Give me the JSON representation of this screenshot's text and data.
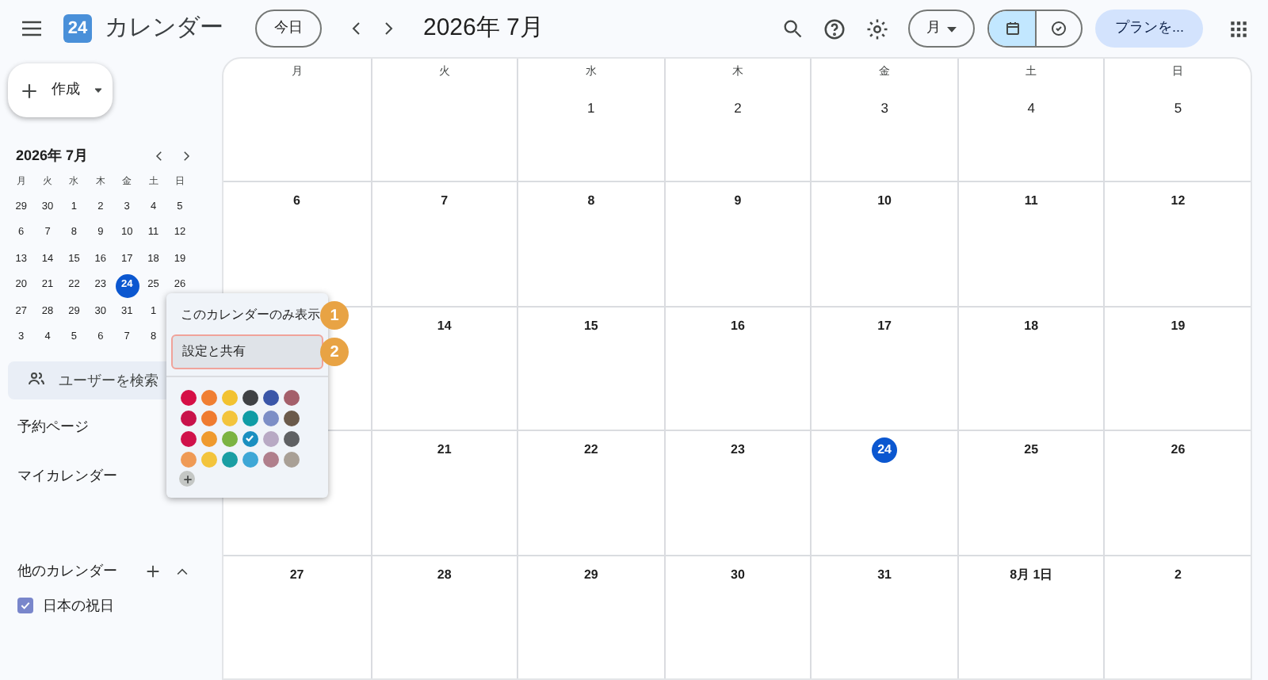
{
  "header": {
    "app_name": "カレンダー",
    "logo_text": "24",
    "today_button": "今日",
    "period": "2026年 7月",
    "view_button": "月",
    "plan_button": "プランを...",
    "view_toggle": [
      {
        "kind": "calendar",
        "selected": true
      },
      {
        "kind": "tasks",
        "selected": false
      }
    ]
  },
  "sidebar": {
    "create_button": "作成",
    "mini_calendar": {
      "title": "2026年 7月",
      "weekdays": [
        "月",
        "火",
        "水",
        "木",
        "金",
        "土",
        "日"
      ],
      "weeks": [
        [
          {
            "day": "29",
            "today": false
          },
          {
            "day": "30",
            "today": false
          },
          {
            "day": "1",
            "today": false
          },
          {
            "day": "2",
            "today": false
          },
          {
            "day": "3",
            "today": false
          },
          {
            "day": "4",
            "today": false
          },
          {
            "day": "5",
            "today": false
          }
        ],
        [
          {
            "day": "6",
            "today": false
          },
          {
            "day": "7",
            "today": false
          },
          {
            "day": "8",
            "today": false
          },
          {
            "day": "9",
            "today": false
          },
          {
            "day": "10",
            "today": false
          },
          {
            "day": "11",
            "today": false
          },
          {
            "day": "12",
            "today": false
          }
        ],
        [
          {
            "day": "13",
            "today": false
          },
          {
            "day": "14",
            "today": false
          },
          {
            "day": "15",
            "today": false
          },
          {
            "day": "16",
            "today": false
          },
          {
            "day": "17",
            "today": false
          },
          {
            "day": "18",
            "today": false
          },
          {
            "day": "19",
            "today": false
          }
        ],
        [
          {
            "day": "20",
            "today": false
          },
          {
            "day": "21",
            "today": false
          },
          {
            "day": "22",
            "today": false
          },
          {
            "day": "23",
            "today": false
          },
          {
            "day": "24",
            "today": true
          },
          {
            "day": "25",
            "today": false
          },
          {
            "day": "26",
            "today": false
          }
        ],
        [
          {
            "day": "27",
            "today": false
          },
          {
            "day": "28",
            "today": false
          },
          {
            "day": "29",
            "today": false
          },
          {
            "day": "30",
            "today": false
          },
          {
            "day": "31",
            "today": false
          },
          {
            "day": "1",
            "today": false
          }
        ],
        [
          {
            "day": "3",
            "today": false
          },
          {
            "day": "4",
            "today": false
          },
          {
            "day": "5",
            "today": false
          },
          {
            "day": "6",
            "today": false
          },
          {
            "day": "7",
            "today": false
          },
          {
            "day": "8",
            "today": false
          }
        ]
      ]
    },
    "search": {
      "placeholder": "ユーザーを検索"
    },
    "booking": "予約ページ",
    "my_calendars": "マイカレンダー",
    "other_calendars": "他のカレンダー",
    "calendars": [
      {
        "label": "日本の祝日",
        "checked": true
      }
    ]
  },
  "month": {
    "weekdays": [
      "月",
      "火",
      "水",
      "木",
      "金",
      "土",
      "日"
    ],
    "weeks": [
      [
        {
          "today": false
        },
        {
          "today": false
        },
        {
          "day": "1",
          "today": false
        },
        {
          "day": "2",
          "today": false
        },
        {
          "day": "3",
          "today": false
        },
        {
          "day": "4",
          "today": false
        },
        {
          "day": "5",
          "today": false
        }
      ],
      [
        {
          "day": "6",
          "today": false
        },
        {
          "day": "7",
          "today": false
        },
        {
          "day": "8",
          "today": false
        },
        {
          "day": "9",
          "today": false
        },
        {
          "day": "10",
          "today": false
        },
        {
          "day": "11",
          "today": false
        },
        {
          "day": "12",
          "today": false
        }
      ],
      [
        {
          "today": false
        },
        {
          "day": "14",
          "today": false
        },
        {
          "day": "15",
          "today": false
        },
        {
          "day": "16",
          "today": false
        },
        {
          "day": "17",
          "today": false
        },
        {
          "day": "18",
          "today": false
        },
        {
          "day": "19",
          "today": false
        }
      ],
      [
        {
          "today": false
        },
        {
          "day": "21",
          "today": false
        },
        {
          "day": "22",
          "today": false
        },
        {
          "day": "23",
          "today": false
        },
        {
          "day": "24",
          "today": true
        },
        {
          "day": "25",
          "today": false
        },
        {
          "day": "26",
          "today": false
        }
      ],
      [
        {
          "day": "27",
          "today": false
        },
        {
          "day": "28",
          "today": false
        },
        {
          "day": "29",
          "today": false
        },
        {
          "day": "30",
          "today": false
        },
        {
          "day": "31",
          "today": false
        },
        {
          "day": "8月 1日",
          "today": false
        },
        {
          "day": "2",
          "today": false
        }
      ]
    ]
  },
  "context_menu": {
    "items": [
      {
        "label": "このカレンダーのみ表示",
        "highlighted": false,
        "callout": "1"
      },
      {
        "label": "設定と共有",
        "highlighted": true,
        "callout": "2"
      }
    ],
    "swatches": [
      {
        "color": "#d50f46",
        "selected": false
      },
      {
        "color": "#f07f33",
        "selected": false
      },
      {
        "color": "#f2c230",
        "selected": false
      },
      {
        "color": "#3f4144",
        "selected": false
      },
      {
        "color": "#3a56a8",
        "selected": false
      },
      {
        "color": "#a45f6a",
        "selected": false
      },
      {
        "color": "#c8124a",
        "selected": false
      },
      {
        "color": "#ef7b30",
        "selected": false
      },
      {
        "color": "#f3c43c",
        "selected": false
      },
      {
        "color": "#0f9ca5",
        "selected": false
      },
      {
        "color": "#7c8ec6",
        "selected": false
      },
      {
        "color": "#6b5a4a",
        "selected": false
      },
      {
        "color": "#d0114a",
        "selected": false
      },
      {
        "color": "#ef9a2e",
        "selected": false
      },
      {
        "color": "#7bb342",
        "selected": false
      },
      {
        "color": "#1a8fc0",
        "selected": true
      },
      {
        "color": "#b8a9c4",
        "selected": false
      },
      {
        "color": "#5f6163",
        "selected": false
      },
      {
        "color": "#ef9a55",
        "selected": false
      },
      {
        "color": "#f3c43c",
        "selected": false
      },
      {
        "color": "#1a9ea3",
        "selected": false
      },
      {
        "color": "#3ea7d6",
        "selected": false
      },
      {
        "color": "#b07f8c",
        "selected": false
      },
      {
        "color": "#a9a096",
        "selected": false
      }
    ]
  }
}
